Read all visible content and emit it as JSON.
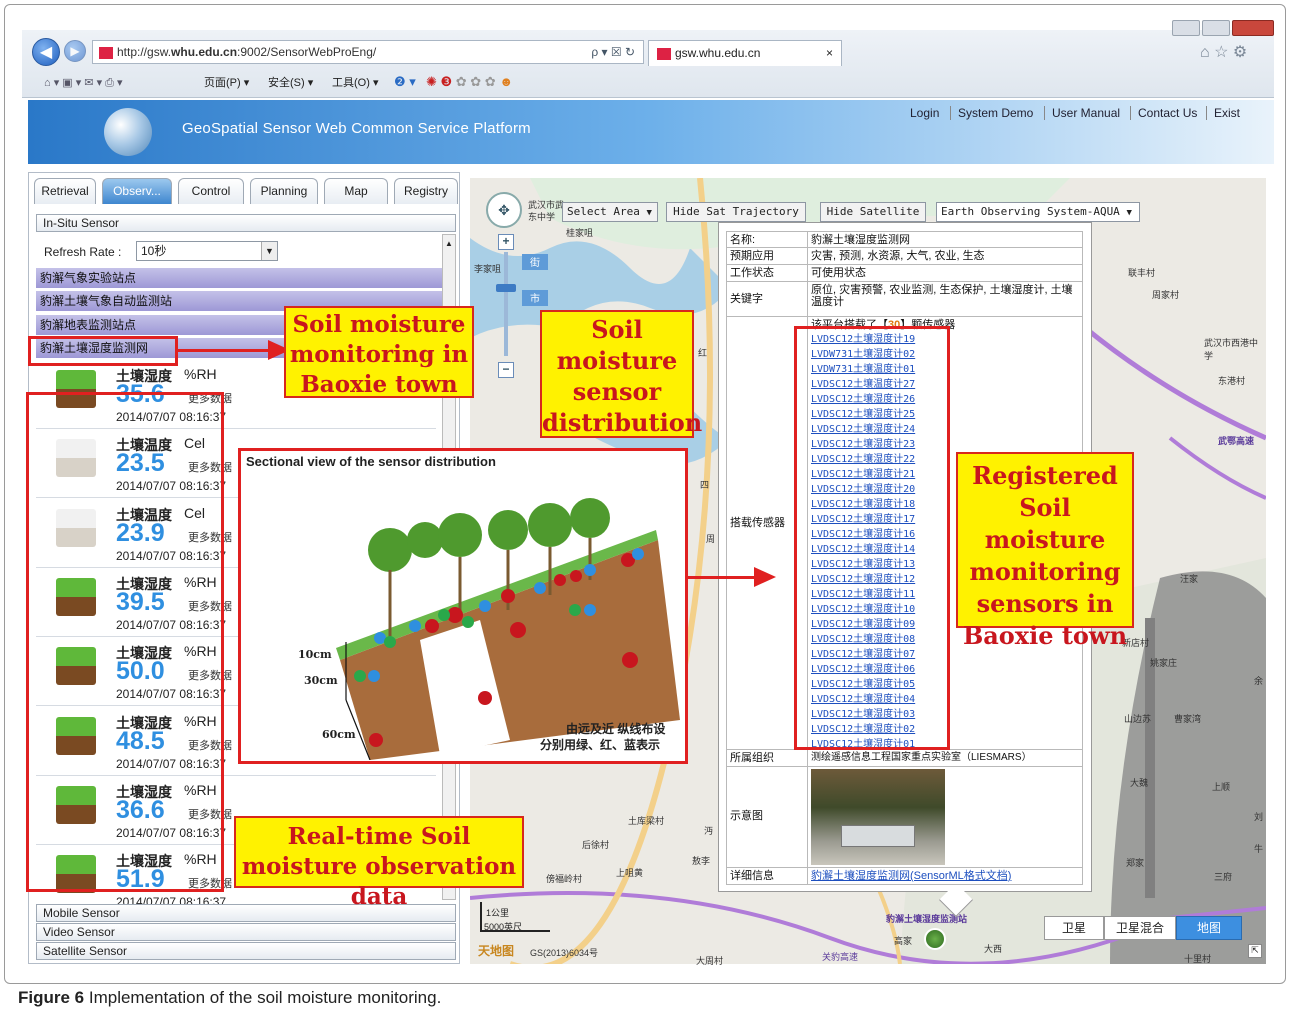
{
  "browser": {
    "url": "http://gsw.whu.edu.cn:9002/SensorWebProEng/",
    "url_prefix": "http://gsw.",
    "url_host": "whu.edu.cn",
    "url_suffix": ":9002/SensorWebProEng/",
    "tab_title": "gsw.whu.edu.cn",
    "tab_close": "×",
    "addr_icons": "ρ ▾ ☒ ↻",
    "commands": {
      "page": "页面(P) ▾",
      "security": "安全(S) ▾",
      "tools": "工具(O) ▾"
    }
  },
  "app": {
    "title": "GeoSpatial Sensor Web Common Service Platform",
    "top_links": [
      "Login",
      "System Demo",
      "User Manual",
      "Contact Us",
      "Exist"
    ]
  },
  "left_panel": {
    "tabs": [
      "Retrieval",
      "Observ...",
      "Control",
      "Planning",
      "Map",
      "Registry"
    ],
    "in_situ_header": "In-Situ Sensor",
    "refresh_label": "Refresh Rate :",
    "refresh_value": "10秒",
    "stations": [
      "豹澥气象实验站点",
      "豹澥土壤气象自动监测站",
      "豹澥地表监测站点",
      "豹澥土壤湿度监测网"
    ],
    "readings": [
      {
        "name": "土壤湿度",
        "unit": "%RH",
        "value": "35.6",
        "more": "更多数据",
        "time": "2014/07/07 08:16:37",
        "cube": "green"
      },
      {
        "name": "土壤温度",
        "unit": "Cel",
        "value": "23.5",
        "more": "更多数据",
        "time": "2014/07/07 08:16:37",
        "cube": "white"
      },
      {
        "name": "土壤温度",
        "unit": "Cel",
        "value": "23.9",
        "more": "更多数据",
        "time": "2014/07/07 08:16:37",
        "cube": "white"
      },
      {
        "name": "土壤湿度",
        "unit": "%RH",
        "value": "39.5",
        "more": "更多数据",
        "time": "2014/07/07 08:16:37",
        "cube": "green"
      },
      {
        "name": "土壤湿度",
        "unit": "%RH",
        "value": "50.0",
        "more": "更多数据",
        "time": "2014/07/07 08:16:37",
        "cube": "green"
      },
      {
        "name": "土壤湿度",
        "unit": "%RH",
        "value": "48.5",
        "more": "更多数据",
        "time": "2014/07/07 08:16:37",
        "cube": "green"
      },
      {
        "name": "土壤湿度",
        "unit": "%RH",
        "value": "36.6",
        "more": "更多数据",
        "time": "2014/07/07 08:16:37",
        "cube": "green"
      },
      {
        "name": "土壤湿度",
        "unit": "%RH",
        "value": "51.9",
        "more": "更多数据",
        "time": "2014/07/07 08:16:37",
        "cube": "green"
      }
    ],
    "bottom_sections": [
      "Mobile Sensor",
      "Video Sensor",
      "Satellite Sensor"
    ]
  },
  "map": {
    "select_area": "Select Area",
    "hide_sat_traj": "Hide Sat Trajectory",
    "hide_satellite": "Hide Satellite",
    "satellite_select": "Earth Observing System-AQUA",
    "labels": [
      "武汉市武",
      "东中学",
      "桂家咀",
      "李家咀",
      "街",
      "市",
      "红",
      "联丰村",
      "周家村",
      "武汉市西港中学",
      "东港村",
      "武鄂高速",
      "汪家",
      "新店村",
      "姚家庄",
      "山边苏",
      "曹家湾",
      "大魏",
      "上顺",
      "郑家",
      "三府",
      "刘",
      "牛",
      "余",
      "后徐村",
      "土库梁村",
      "傍福岭村",
      "敖李",
      "上咀黄",
      "高家",
      "大西",
      "大周村",
      "关豹高速",
      "十里村",
      "周",
      "四",
      "沔",
      "豹澥土壤湿度监测站"
    ],
    "scale": "5000英尺",
    "scale_label": "1公里",
    "copyright": "GS(2013)6034号",
    "brand": "天地图",
    "view_buttons": [
      "卫星",
      "卫星混合",
      "地图"
    ],
    "active_view": "地图"
  },
  "popup": {
    "rows": [
      {
        "key": "名称:",
        "value": "豹澥土壤湿度监测网"
      },
      {
        "key": "预期应用",
        "value": "灾害, 预测, 水资源, 大气, 农业, 生态"
      },
      {
        "key": "工作状态",
        "value": "可使用状态"
      },
      {
        "key": "关键字",
        "value": "原位, 灾害预警, 农业监测, 生态保护, 土壤湿度计, 土壤温度计"
      }
    ],
    "sensor_key": "搭载传感器",
    "sensor_intro_a": "该平台搭载了【",
    "sensor_count": "30",
    "sensor_intro_b": "】颗传感器",
    "sensors": [
      "LVDSC12土壤湿度计19",
      "LVDW731土壤湿度计02",
      "LVDW731土壤温度计01",
      "LVDSC12土壤温度计27",
      "LVDSC12土壤湿度计26",
      "LVDSC12土壤湿度计25",
      "LVDSC12土壤湿度计24",
      "LVDSC12土壤湿度计23",
      "LVDSC12土壤湿度计22",
      "LVDSC12土壤湿度计21",
      "LVDSC12土壤湿度计20",
      "LVDSC12土壤湿度计18",
      "LVDSC12土壤湿度计17",
      "LVDSC12土壤湿度计16",
      "LVDSC12土壤湿度计14",
      "LVDSC12土壤湿度计13",
      "LVDSC12土壤湿度计12",
      "LVDSC12土壤湿度计11",
      "LVDSC12土壤湿度计10",
      "LVDSC12土壤湿度计09",
      "LVDSC12土壤湿度计08",
      "LVDSC12土壤湿度计07",
      "LVDSC12土壤湿度计06",
      "LVDSC12土壤湿度计05",
      "LVDSC12土壤湿度计04",
      "LVDSC12土壤湿度计03",
      "LVDSC12土壤湿度计02",
      "LVDSC12土壤湿度计01"
    ],
    "org_key": "所属组织",
    "org_value": "测绘遥感信息工程国家重点实验室（LIESMARS）",
    "image_key": "示意图",
    "detail_key": "详细信息",
    "detail_link": "豹澥土壤湿度监测网(SensorML格式文档)"
  },
  "annotations": {
    "soil_moisture_baoxie": "Soil moisture monitoring in Baoxie town",
    "sensor_distribution": "Soil moisture sensor distribution",
    "registered": "Registered Soil moisture monitoring sensors in Baoxie town",
    "realtime": "Real-time Soil moisture observation data",
    "sectional_title": "Sectional view of the sensor distribution",
    "depth_10": "10cm",
    "depth_30": "30cm",
    "depth_60": "60cm",
    "legend_line1": "由远及近 纵线布设",
    "legend_line2": "分别用绿、红、蓝表示"
  },
  "caption": {
    "label": "Figure 6",
    "text": "Implementation of the soil moisture monitoring."
  },
  "colors": {
    "accent_red": "#e02020",
    "annotation_yellow": "#fff200",
    "value_blue": "#2f8fe0",
    "station_purple": "#a7a2dc"
  }
}
